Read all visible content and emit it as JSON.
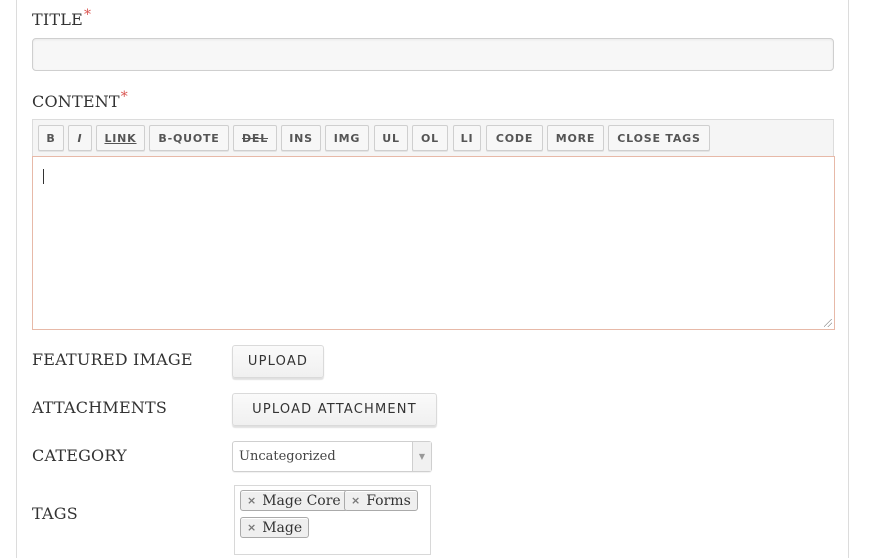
{
  "form": {
    "title_label": "TITLE",
    "content_label": "CONTENT",
    "required_mark": "*",
    "title_value": ""
  },
  "toolbar": {
    "buttons": [
      "B",
      "I",
      "LINK",
      "B-QUOTE",
      "DEL",
      "INS",
      "IMG",
      "UL",
      "OL",
      "LI",
      "CODE",
      "MORE",
      "CLOSE TAGS"
    ]
  },
  "editor": {
    "value": ""
  },
  "featured_image": {
    "label": "FEATURED IMAGE",
    "button": "UPLOAD"
  },
  "attachments": {
    "label": "ATTACHMENTS",
    "button": "UPLOAD ATTACHMENT"
  },
  "category": {
    "label": "CATEGORY",
    "selected": "Uncategorized",
    "arrow": "▼"
  },
  "tags": {
    "label": "TAGS",
    "items": [
      "Mage Core",
      "Forms",
      "Mage"
    ],
    "remove_glyph": "×"
  },
  "colors": {
    "required": "#d9534f",
    "editor_border": "#e7b9a8"
  }
}
